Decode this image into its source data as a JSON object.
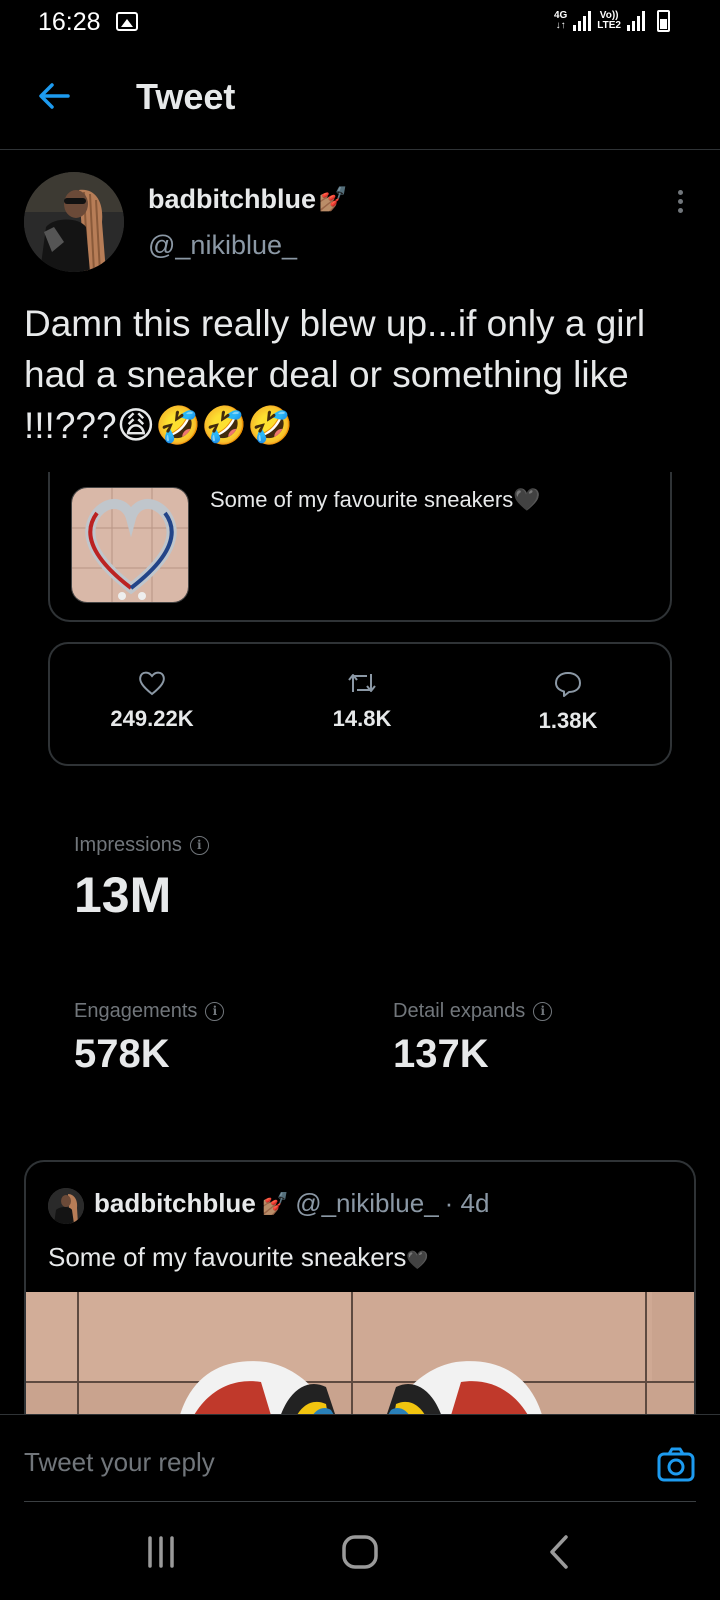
{
  "status_bar": {
    "time": "16:28",
    "network_1": "4G",
    "network_2_line1": "Vo))",
    "network_2_line2": "LTE2"
  },
  "header": {
    "title": "Tweet",
    "back_icon": "arrow-left-icon"
  },
  "tweet": {
    "display_name": "badbitchblue",
    "handle": "@_nikiblue_",
    "text": "Damn this really blew up...if only a girl had a sneaker deal or something like !!!???😩🤣🤣🤣",
    "quoted_preview_text": "Some of my favourite sneakers🖤"
  },
  "metrics": {
    "likes": "249.22K",
    "retweets": "14.8K",
    "replies": "1.38K"
  },
  "analytics": {
    "impressions_label": "Impressions",
    "impressions_value": "13M",
    "engagements_label": "Engagements",
    "engagements_value": "578K",
    "detail_expands_label": "Detail expands",
    "detail_expands_value": "137K"
  },
  "quoted_tweet": {
    "display_name": "badbitchblue",
    "handle": "@_nikiblue_",
    "time": "· 4d",
    "text": "Some of my favourite sneakers"
  },
  "reply": {
    "placeholder": "Tweet your reply"
  },
  "colors": {
    "accent": "#1d9bf0",
    "background": "#000000",
    "border": "#2f3336",
    "secondary_text": "#71767b"
  }
}
